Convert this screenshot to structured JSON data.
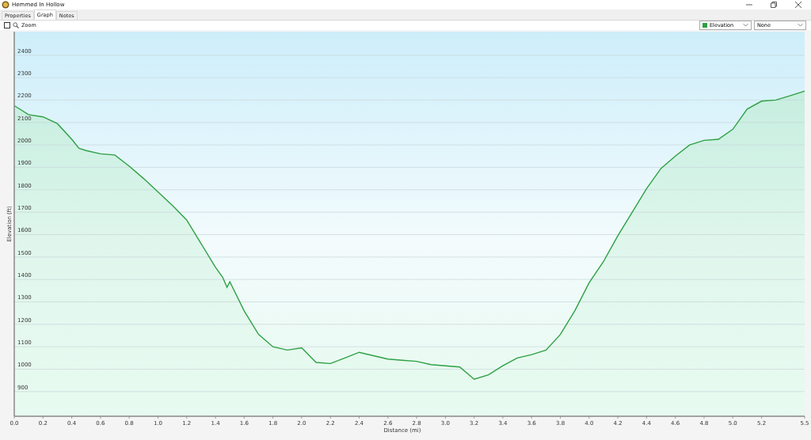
{
  "window": {
    "title": "Hemmed In Hollow"
  },
  "tabs": [
    {
      "label": "Properties",
      "selected": false
    },
    {
      "label": "Graph",
      "selected": true
    },
    {
      "label": "Notes",
      "selected": false
    }
  ],
  "toolbar": {
    "zoom": {
      "label": "Zoom",
      "checked": false
    },
    "second_select": {
      "value": "None"
    }
  },
  "chart": {
    "chart_data": {
      "type": "area",
      "grid": true,
      "xlabel": "Distance  (mi)",
      "ylabel": "Elevation (ft)",
      "x": [
        0,
        0.1,
        0.2,
        0.3,
        0.4,
        0.45,
        0.5,
        0.6,
        0.7,
        0.8,
        0.9,
        1.0,
        1.1,
        1.2,
        1.3,
        1.4,
        1.45,
        1.48,
        1.5,
        1.6,
        1.7,
        1.8,
        1.9,
        2.0,
        2.1,
        2.2,
        2.3,
        2.4,
        2.5,
        2.6,
        2.7,
        2.8,
        2.9,
        3.0,
        3.1,
        3.2,
        3.3,
        3.4,
        3.5,
        3.6,
        3.7,
        3.8,
        3.9,
        4.0,
        4.1,
        4.2,
        4.3,
        4.4,
        4.5,
        4.6,
        4.7,
        4.8,
        4.9,
        5.0,
        5.1,
        5.2,
        5.3,
        5.4,
        5.5
      ],
      "series": [
        {
          "name": "Elevation",
          "color": "#2ea043",
          "values": [
            2175,
            2135,
            2125,
            2095,
            2025,
            1985,
            1975,
            1960,
            1955,
            1905,
            1850,
            1790,
            1730,
            1665,
            1560,
            1455,
            1410,
            1365,
            1390,
            1260,
            1155,
            1100,
            1085,
            1095,
            1030,
            1025,
            1050,
            1075,
            1060,
            1045,
            1040,
            1035,
            1020,
            1015,
            1010,
            955,
            975,
            1015,
            1050,
            1065,
            1085,
            1155,
            1260,
            1385,
            1480,
            1595,
            1700,
            1805,
            1895,
            1950,
            2000,
            2020,
            2025,
            2070,
            2160,
            2195,
            2200,
            2220,
            2240
          ]
        }
      ],
      "xlim": [
        0,
        5.5
      ],
      "ylim": [
        790,
        2505
      ],
      "xticks": [
        {
          "value": 0,
          "label": "0.0"
        },
        {
          "value": 0.2,
          "label": "0.2"
        },
        {
          "value": 0.4,
          "label": "0.4"
        },
        {
          "value": 0.6,
          "label": "0.6"
        },
        {
          "value": 0.8,
          "label": "0.8"
        },
        {
          "value": 1.0,
          "label": "1.0"
        },
        {
          "value": 1.2,
          "label": "1.2"
        },
        {
          "value": 1.4,
          "label": "1.4"
        },
        {
          "value": 1.6,
          "label": "1.6"
        },
        {
          "value": 1.8,
          "label": "1.8"
        },
        {
          "value": 2.0,
          "label": "2.0"
        },
        {
          "value": 2.2,
          "label": "2.2"
        },
        {
          "value": 2.4,
          "label": "2.4"
        },
        {
          "value": 2.6,
          "label": "2.6"
        },
        {
          "value": 2.8,
          "label": "2.8"
        },
        {
          "value": 3.0,
          "label": "3.0"
        },
        {
          "value": 3.2,
          "label": "3.2"
        },
        {
          "value": 3.4,
          "label": "3.4"
        },
        {
          "value": 3.6,
          "label": "3.6"
        },
        {
          "value": 3.8,
          "label": "3.8"
        },
        {
          "value": 4.0,
          "label": "4.0"
        },
        {
          "value": 4.2,
          "label": "4.2"
        },
        {
          "value": 4.4,
          "label": "4.4"
        },
        {
          "value": 4.6,
          "label": "4.6"
        },
        {
          "value": 4.8,
          "label": "4.8"
        },
        {
          "value": 5.0,
          "label": "5.0"
        },
        {
          "value": 5.2,
          "label": "5.2"
        },
        {
          "value": 5.5,
          "label": "5.5"
        }
      ],
      "yticks": [
        900,
        1000,
        1100,
        1200,
        1300,
        1400,
        1500,
        1600,
        1700,
        1800,
        1900,
        2000,
        2100,
        2200,
        2300,
        2400
      ]
    }
  }
}
